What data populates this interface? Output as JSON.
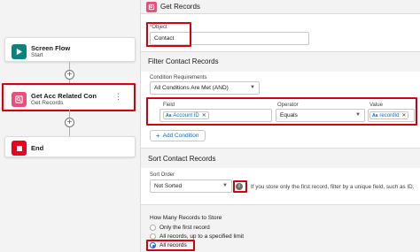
{
  "flow": {
    "nodes": [
      {
        "title": "Screen Flow",
        "subtitle": "Start",
        "icon": "play-icon",
        "color": "#0b827c"
      },
      {
        "title": "Get Acc Related Con",
        "subtitle": "Get Records",
        "icon": "get-records-icon",
        "color": "#e84f7a",
        "menu": "⋮"
      },
      {
        "title": "End",
        "subtitle": "",
        "icon": "stop-icon",
        "color": "#ea001e"
      }
    ],
    "add_symbol": "+"
  },
  "panel": {
    "title": "Get Records",
    "object": {
      "label": "Object",
      "required_mark": "*",
      "value": "Contact"
    },
    "filter": {
      "title": "Filter Contact Records",
      "condition_label": "Condition Requirements",
      "condition_value": "All Conditions Are Met (AND)",
      "field_label": "Field",
      "field_value": "Account ID",
      "operator_label": "Operator",
      "operator_value": "Equals",
      "value_label": "Value",
      "value_value": "recordId",
      "add_condition": "Add Condition",
      "add_symbol": "+"
    },
    "sort": {
      "title": "Sort Contact Records",
      "order_label": "Sort Order",
      "order_value": "Not Sorted",
      "info_text": "If you store only the first record, filter by a unique field, such as ID."
    },
    "store": {
      "title": "How Many Records to Store",
      "options": [
        "Only the first record",
        "All records, up to a specified limit",
        "All records"
      ],
      "selected": 2
    }
  },
  "colors": {
    "highlight": "#d4000f",
    "link": "#0070d2"
  }
}
